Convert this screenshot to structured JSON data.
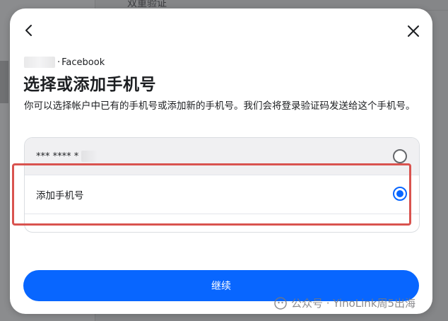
{
  "backdrop": {
    "partial_text": "双重验证"
  },
  "dialog": {
    "account": {
      "separator": "·",
      "app_name": "Facebook"
    },
    "title": "选择或添加手机号",
    "description": "你可以选择帐户中已有的手机号或添加新的手机号。我们会将登录验证码发送给这个手机号。",
    "options": [
      {
        "label": "*** **** *",
        "selected": false
      },
      {
        "label": "添加手机号",
        "selected": true
      }
    ],
    "continue_label": "继续",
    "icons": {
      "back": "chevron-left-icon",
      "close": "close-icon"
    },
    "colors": {
      "accent": "#0866ff",
      "highlight": "#d9534f"
    }
  },
  "watermark": {
    "text": "公众号 · YinoLink周5出海"
  }
}
